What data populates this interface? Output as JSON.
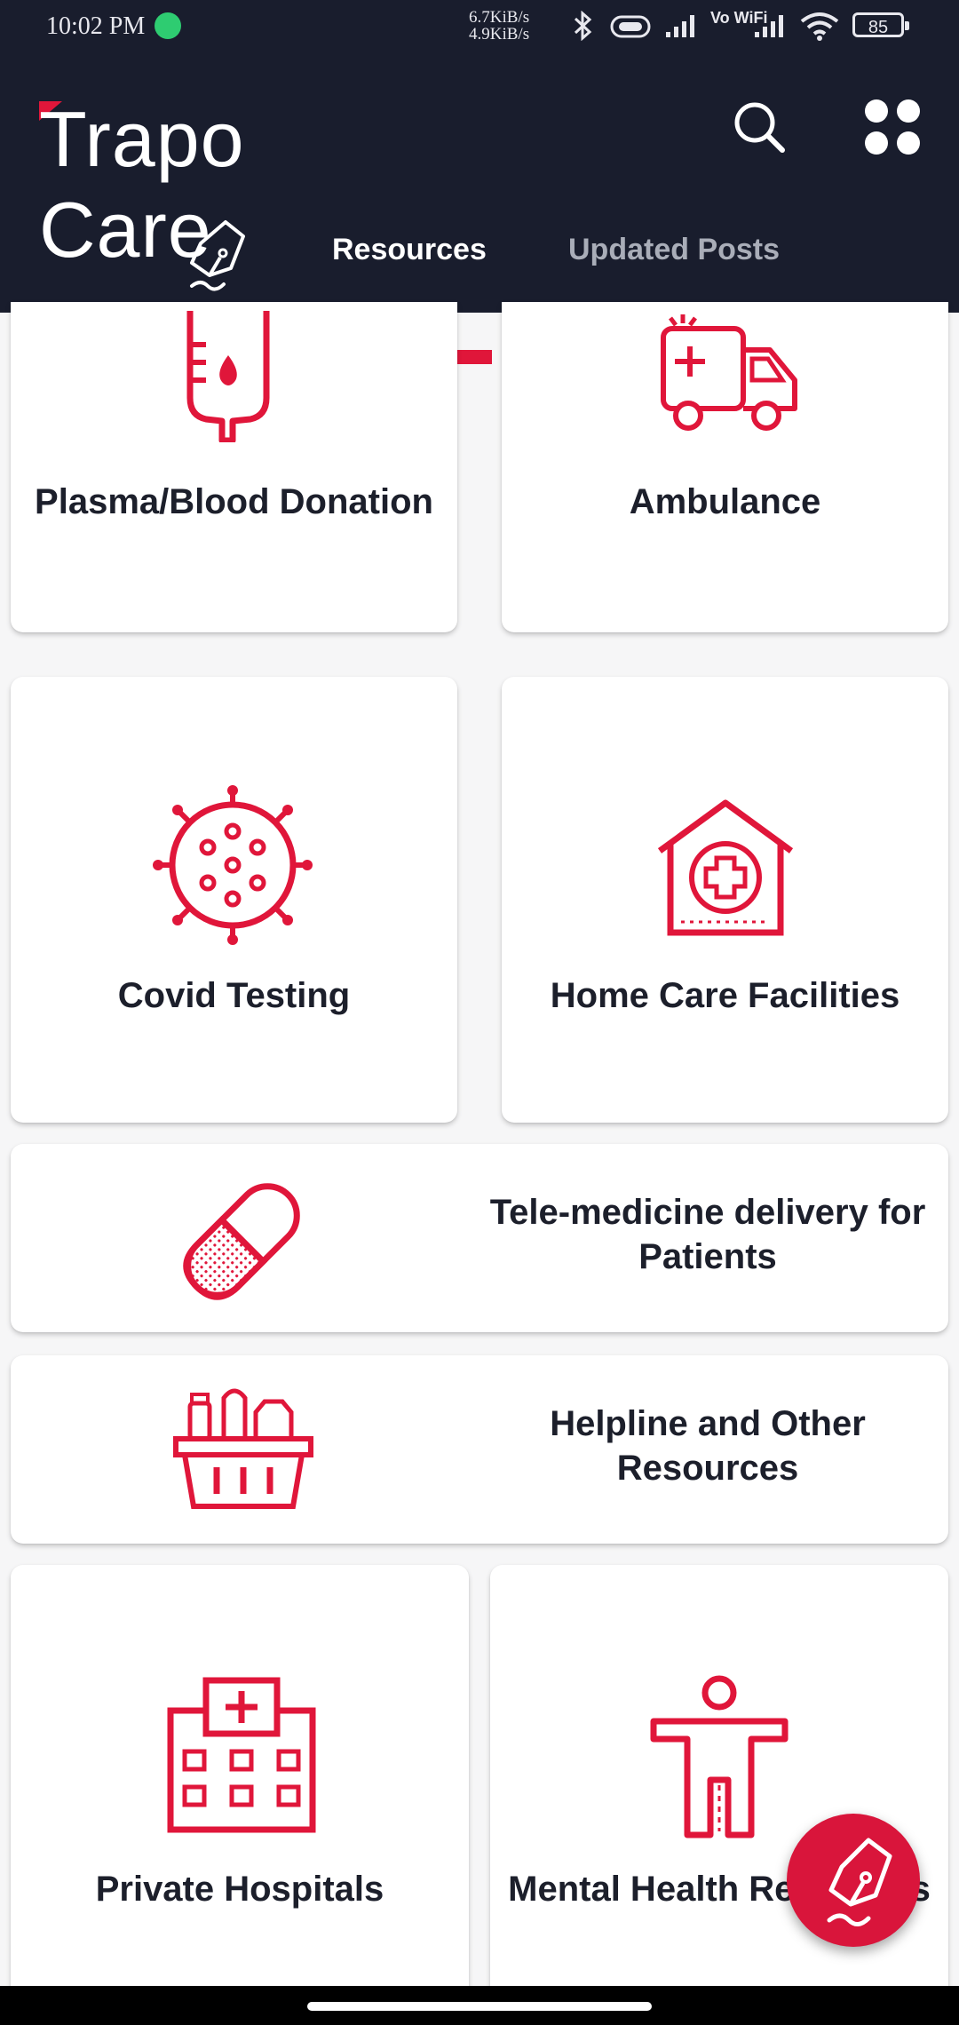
{
  "status_bar": {
    "time": "10:02 PM",
    "speed_up": "6.7KiB/s",
    "speed_down": "4.9KiB/s",
    "vowifi": "Vo WiFi",
    "battery": "85"
  },
  "header": {
    "logo_text": "Trapo Care",
    "tabs": [
      {
        "label": "Resources",
        "active": true
      },
      {
        "label": "Updated Posts",
        "active": false
      }
    ]
  },
  "resources": [
    {
      "label": "Plasma/Blood Donation",
      "icon": "blood-bag-icon"
    },
    {
      "label": "Ambulance",
      "icon": "ambulance-icon"
    },
    {
      "label": "Covid Testing",
      "icon": "virus-icon"
    },
    {
      "label": "Home Care Facilities",
      "icon": "home-care-icon"
    },
    {
      "label": "Tele-medicine delivery for Patients",
      "icon": "pill-icon"
    },
    {
      "label": "Helpline and Other Resources",
      "icon": "grocery-basket-icon"
    },
    {
      "label": "Private Hospitals",
      "icon": "hospital-icon"
    },
    {
      "label": "Mental Health Resources",
      "icon": "person-icon"
    }
  ],
  "colors": {
    "accent": "#e0163a",
    "header_bg": "#191d2d",
    "text_dark": "#1c1f2b"
  }
}
